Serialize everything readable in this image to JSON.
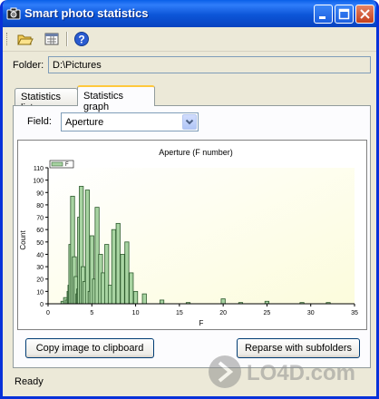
{
  "window": {
    "title": "Smart photo statistics",
    "accent": "#0c55d8"
  },
  "toolbar": {
    "open_icon": "open-folder-icon",
    "report_icon": "report-icon",
    "help_icon": "help-icon"
  },
  "folder": {
    "label": "Folder:",
    "value": "D:\\Pictures"
  },
  "tabs": [
    {
      "label": "Statistics list",
      "active": false
    },
    {
      "label": "Statistics graph",
      "active": true
    }
  ],
  "field": {
    "label": "Field:",
    "selected": "Aperture"
  },
  "chart_data": {
    "type": "bar",
    "title": "Aperture (F number)",
    "xlabel": "F",
    "ylabel": "Count",
    "legend": [
      "F"
    ],
    "legend_position": "top-left",
    "xlim": [
      0,
      35
    ],
    "ylim": [
      0,
      110
    ],
    "xticks": [
      0,
      5,
      10,
      15,
      20,
      25,
      30,
      35
    ],
    "yticks": [
      0,
      10,
      20,
      30,
      40,
      50,
      60,
      70,
      80,
      90,
      100,
      110
    ],
    "grid": false,
    "colors": {
      "bar": "#a8d4a2",
      "bar_stroke": "#2d5a2d",
      "plot_bg": "#fcfcdc"
    },
    "x": [
      1.7,
      2.0,
      2.2,
      2.4,
      2.5,
      2.6,
      2.8,
      3.0,
      3.2,
      3.4,
      3.5,
      3.6,
      3.8,
      4.0,
      4.2,
      4.5,
      4.8,
      5.0,
      5.3,
      5.6,
      6.0,
      6.3,
      6.7,
      7.1,
      7.5,
      8.0,
      8.5,
      9.0,
      9.5,
      10.0,
      11.0,
      13.0,
      16.0,
      20.0,
      22.0,
      25.0,
      29.0,
      32.0
    ],
    "values": [
      2,
      5,
      3,
      10,
      15,
      48,
      87,
      38,
      22,
      8,
      12,
      70,
      95,
      30,
      18,
      92,
      10,
      55,
      20,
      78,
      40,
      25,
      48,
      15,
      60,
      65,
      40,
      50,
      25,
      10,
      8,
      3,
      1,
      4,
      1,
      2,
      1,
      1
    ]
  },
  "buttons": {
    "copy_label": "Copy image to clipboard",
    "reparse_label": "Reparse with subfolders"
  },
  "status": {
    "text": "Ready"
  },
  "watermark": {
    "text": "LO4D.com"
  }
}
